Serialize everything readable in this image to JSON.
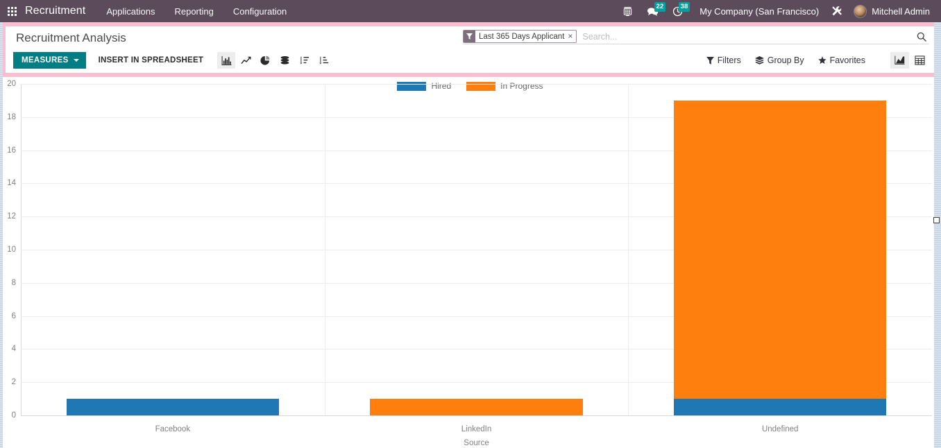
{
  "navbar": {
    "apps_icon": "apps-grid-icon",
    "brand": "Recruitment",
    "menus": [
      {
        "label": "Applications"
      },
      {
        "label": "Reporting"
      },
      {
        "label": "Configuration"
      }
    ],
    "voip_icon": "telephone-icon",
    "messages": {
      "icon": "chat-bubble-icon",
      "count": "22"
    },
    "activities": {
      "icon": "clock-icon",
      "count": "38"
    },
    "company": "My Company (San Francisco)",
    "debug_icon": "wrench-icon",
    "user": {
      "name": "Mitchell Admin",
      "avatar": "user-avatar"
    }
  },
  "control_panel": {
    "title": "Recruitment Analysis",
    "measures_label": "MEASURES",
    "spreadsheet_label": "INSERT IN SPREADSHEET",
    "graph_type_icons": [
      {
        "name": "bar-chart-icon",
        "active": true
      },
      {
        "name": "line-chart-icon",
        "active": false
      },
      {
        "name": "pie-chart-icon",
        "active": false
      },
      {
        "name": "stacked-icon",
        "active": false
      },
      {
        "name": "sort-descending-icon",
        "active": false
      },
      {
        "name": "sort-ascending-icon",
        "active": false
      }
    ],
    "search": {
      "facet_label": "Last 365 Days Applicant",
      "facet_remove": "×",
      "placeholder": "Search...",
      "search_icon": "search-icon"
    },
    "filters_label": "Filters",
    "groupby_label": "Group By",
    "favorites_label": "Favorites",
    "view_icons": [
      {
        "name": "graph-view-icon",
        "active": true
      },
      {
        "name": "pivot-view-icon",
        "active": false
      }
    ]
  },
  "chart_data": {
    "type": "bar",
    "stacked": true,
    "title": "",
    "xlabel": "Source",
    "ylabel": "",
    "categories": [
      "Facebook",
      "LinkedIn",
      "Undefined"
    ],
    "series": [
      {
        "name": "Hired",
        "color": "#1f77b4",
        "values": [
          1,
          0,
          1
        ]
      },
      {
        "name": "In Progress",
        "color": "#ff7f0e",
        "values": [
          0,
          1,
          18
        ]
      }
    ],
    "ylim": [
      0,
      20
    ],
    "yticks": [
      20,
      18,
      16,
      14,
      12,
      10,
      8,
      6,
      4,
      2,
      0
    ],
    "grid": true,
    "legend_position": "top"
  },
  "colors": {
    "navbar": "#5c4b5b",
    "accent_teal": "#017e84",
    "highlight_pink": "#f9bfd0",
    "badge": "#00a0a0",
    "hired": "#1f77b4",
    "in_progress": "#ff7f0e"
  }
}
